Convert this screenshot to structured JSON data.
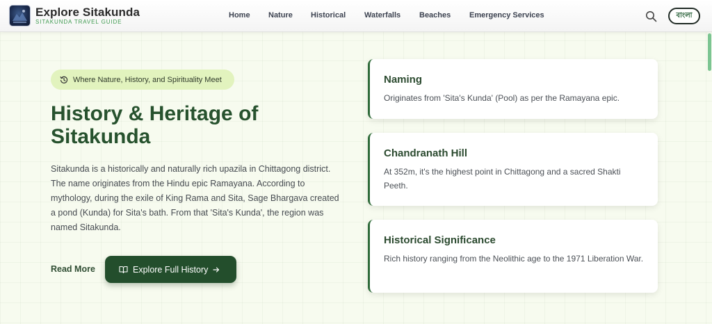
{
  "header": {
    "brand_title": "Explore Sitakunda",
    "brand_subtitle": "SITAKUNDA TRAVEL GUIDE",
    "nav": [
      "Home",
      "Nature",
      "Historical",
      "Waterfalls",
      "Beaches",
      "Emergency Services"
    ],
    "language_button": "বাংলা",
    "icons": {
      "search": "search-icon",
      "logo": "logo-icon"
    }
  },
  "hero": {
    "tagline": "Where Nature, History, and Spirituality Meet",
    "title": "History & Heritage of Sitakunda",
    "intro": "Sitakunda is a historically and naturally rich upazila in Chittagong district. The name originates from the Hindu epic Ramayana. According to mythology, during the exile of King Rama and Sita, Sage Bhargava created a pond (Kunda) for Sita's bath. From that 'Sita's Kunda', the region was named Sitakunda.",
    "read_more": "Read More",
    "explore_button": "Explore Full History"
  },
  "cards": [
    {
      "title": "Naming",
      "text": "Originates from 'Sita's Kunda' (Pool) as per the Ramayana epic."
    },
    {
      "title": "Chandranath Hill",
      "text": "At 352m, it's the highest point in Chittagong and a sacred Shakti Peeth."
    },
    {
      "title": "Historical Significance",
      "text": "Rich history ranging from the Neolithic age to the 1971 Liberation War."
    }
  ],
  "colors": {
    "primary_dark_green": "#234e2c",
    "title_green": "#27522e",
    "tagline_bg": "#e2f3be",
    "accent_green": "#3e9a4f"
  }
}
